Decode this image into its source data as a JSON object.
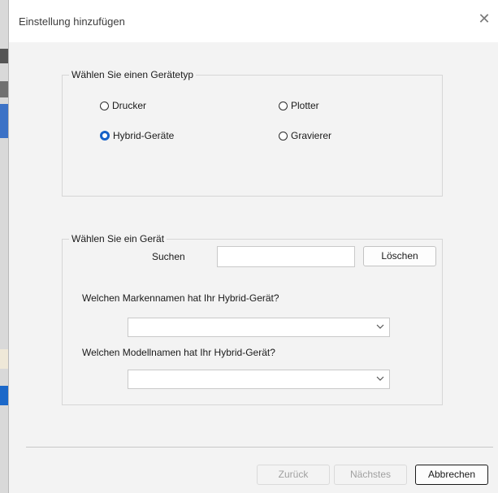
{
  "window": {
    "title": "Einstellung hinzufügen",
    "close_glyph": "✕"
  },
  "device_type": {
    "legend": "Wählen Sie einen Gerätetyp",
    "options": [
      {
        "label": "Drucker",
        "checked": false
      },
      {
        "label": "Plotter",
        "checked": false
      },
      {
        "label": "Hybrid-Geräte",
        "checked": true
      },
      {
        "label": "Gravierer",
        "checked": false
      }
    ]
  },
  "device": {
    "legend": "Wählen Sie ein Gerät",
    "search_label": "Suchen",
    "search_value": "",
    "clear_label": "Löschen",
    "brand_question": "Welchen Markennamen hat Ihr Hybrid-Gerät?",
    "brand_value": "",
    "model_question": "Welchen Modellnamen hat Ihr Hybrid-Gerät?",
    "model_value": ""
  },
  "footer": {
    "back_label": "Zurück",
    "next_label": "Nächstes",
    "cancel_label": "Abbrechen"
  },
  "colors": {
    "accent": "#1560c7",
    "dialog_bg": "#f3f3f3",
    "border": "#d6d6d6"
  }
}
